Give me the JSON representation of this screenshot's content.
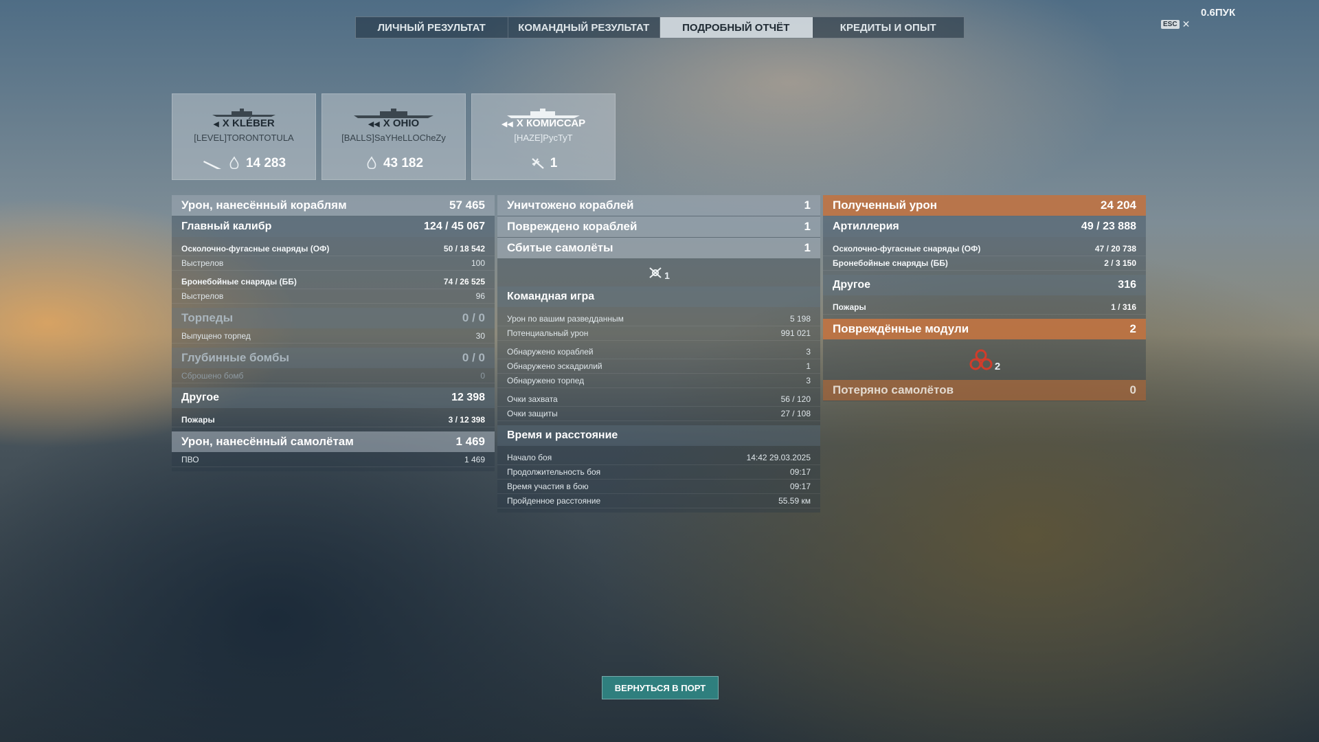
{
  "tabs": [
    "ЛИЧНЫЙ РЕЗУЛЬТАТ",
    "КОМАНДНЫЙ РЕЗУЛЬТАТ",
    "ПОДРОБНЫЙ ОТЧЁТ",
    "КРЕДИТЫ И ОПЫТ"
  ],
  "esc_label": "ESC",
  "close_glyph": "✕",
  "version": "0.6ПУК",
  "cards": [
    {
      "tier": "X",
      "name": "KLÉBER",
      "player": "[LEVEL]TORONTOTULA",
      "stat": "14 283",
      "icons": [
        "torpedo-icon",
        "fire-icon"
      ]
    },
    {
      "tier": "X",
      "name": "OHIO",
      "player": "[BALLS]SaYHeLLOCheZy",
      "stat": "43 182",
      "icons": [
        "fire-icon"
      ]
    },
    {
      "tier": "X",
      "name": "КОМИССАР",
      "player": "[HAZE]PycTyT",
      "stat": "1",
      "icons": [
        "plane-shot-icon"
      ]
    }
  ],
  "left": {
    "damage_ships": {
      "label": "Урон, нанесённый кораблям",
      "value": "57 465"
    },
    "main_caliber": {
      "label": "Главный калибр",
      "hits": "124",
      "value": "45 067"
    },
    "he": {
      "label": "Осколочно-фугасные снаряды (ОФ)",
      "hits": "50",
      "value": "18 542"
    },
    "he_shots": {
      "label": "Выстрелов",
      "value": "100"
    },
    "ap": {
      "label": "Бронебойные снаряды (ББ)",
      "hits": "74",
      "value": "26 525"
    },
    "ap_shots": {
      "label": "Выстрелов",
      "value": "96"
    },
    "torpedoes": {
      "label": "Торпеды",
      "value": "0 / 0"
    },
    "torp_launched": {
      "label": "Выпущено торпед",
      "value": "30"
    },
    "depth": {
      "label": "Глубинные бомбы",
      "value": "0 / 0"
    },
    "bombs_dropped": {
      "label": "Сброшено бомб",
      "value": "0"
    },
    "other": {
      "label": "Другое",
      "value": "12 398"
    },
    "fires": {
      "label": "Пожары",
      "hits": "3",
      "value": "12 398"
    },
    "damage_planes": {
      "label": "Урон, нанесённый самолётам",
      "value": "1 469"
    },
    "aa": {
      "label": "ПВО",
      "value": "1 469"
    }
  },
  "middle": {
    "destroyed": {
      "label": "Уничтожено кораблей",
      "value": "1"
    },
    "damaged": {
      "label": "Повреждено кораблей",
      "value": "1"
    },
    "planes_shot": {
      "label": "Сбитые самолёты",
      "value": "1"
    },
    "planes_icon_count": "1",
    "teamplay_title": "Командная игра",
    "spotting_damage": {
      "label": "Урон по вашим разведданным",
      "value": "5 198"
    },
    "potential_damage": {
      "label": "Потенциальный урон",
      "value": "991 021"
    },
    "ships_spotted": {
      "label": "Обнаружено кораблей",
      "value": "3"
    },
    "squadrons_spotted": {
      "label": "Обнаружено эскадрилий",
      "value": "1"
    },
    "torps_spotted": {
      "label": "Обнаружено торпед",
      "value": "3"
    },
    "capture": {
      "label": "Очки захвата",
      "value": "56 / 120"
    },
    "defense": {
      "label": "Очки защиты",
      "value": "27 / 108"
    },
    "time_title": "Время и расстояние",
    "battle_start": {
      "label": "Начало боя",
      "value": "14:42  29.03.2025"
    },
    "duration": {
      "label": "Продолжительность боя",
      "value": "09:17"
    },
    "participation": {
      "label": "Время участия в бою",
      "value": "09:17"
    },
    "distance": {
      "label": "Пройденное расстояние",
      "value": "55.59 км"
    }
  },
  "right": {
    "received": {
      "label": "Полученный урон",
      "value": "24 204"
    },
    "artillery": {
      "label": "Артиллерия",
      "hits": "49",
      "value": "23 888"
    },
    "he": {
      "label": "Осколочно-фугасные снаряды (ОФ)",
      "hits": "47",
      "value": "20 738"
    },
    "ap": {
      "label": "Бронебойные снаряды (ББ)",
      "hits": "2",
      "value": "3 150"
    },
    "other": {
      "label": "Другое",
      "value": "316"
    },
    "fires": {
      "label": "Пожары",
      "hits": "1",
      "value": "316"
    },
    "modules": {
      "label": "Повреждённые модули",
      "value": "2"
    },
    "modules_icon_count": "2",
    "planes_lost": {
      "label": "Потеряно самолётов",
      "value": "0"
    }
  },
  "return_button": "ВЕРНУТЬСЯ В ПОРТ",
  "colors": {
    "accent_orange": "#d7783c",
    "button_teal": "#2f7f7e",
    "active_tab": "#e1e8ec"
  }
}
